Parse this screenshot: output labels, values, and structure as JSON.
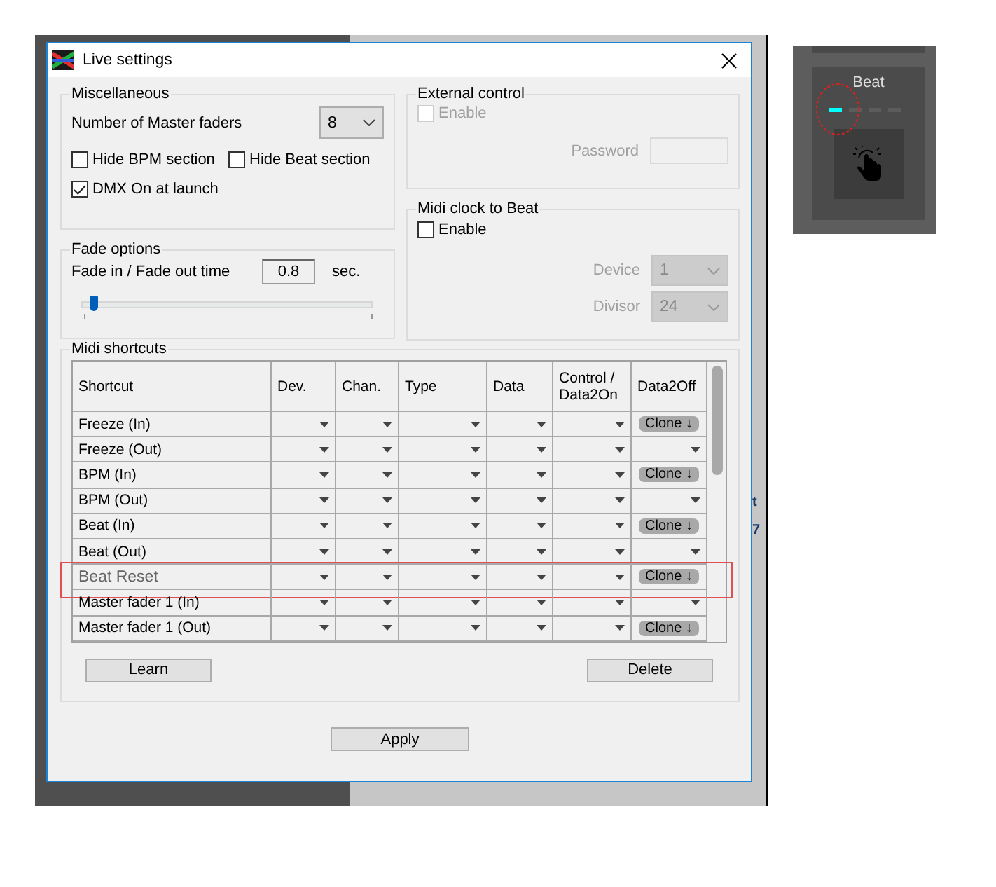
{
  "background": {
    "fragments": [
      "t",
      "7"
    ]
  },
  "beat_panel": {
    "label": "Beat",
    "steps": [
      {
        "active": true
      },
      {
        "active": false
      },
      {
        "active": false
      },
      {
        "active": false
      }
    ],
    "annotated": true
  },
  "window": {
    "title": "Live settings"
  },
  "miscellaneous": {
    "title": "Miscellaneous",
    "master_faders": {
      "label": "Number of Master faders",
      "value": "8"
    },
    "checkboxes": [
      {
        "label": "Hide BPM section",
        "checked": false
      },
      {
        "label": "Hide Beat section",
        "checked": false
      },
      {
        "label": "DMX On at launch",
        "checked": true
      }
    ]
  },
  "fade_options": {
    "title": "Fade options",
    "label": "Fade in / Fade out time",
    "value": "0.8",
    "unit": "sec.",
    "level": 0.04
  },
  "external_control": {
    "title": "External control",
    "enable": {
      "label": "Enable",
      "checked": false,
      "disabled": true
    },
    "password": {
      "label": "Password",
      "disabled": true
    }
  },
  "midi_clock": {
    "title": "Midi clock to Beat",
    "enable": {
      "label": "Enable",
      "checked": false,
      "disabled": false
    },
    "device": {
      "label": "Device",
      "value": "1",
      "disabled": true
    },
    "divisor": {
      "label": "Divisor",
      "value": "24",
      "disabled": true
    }
  },
  "midi_shortcuts": {
    "title": "Midi shortcuts",
    "columns": [
      "Shortcut",
      "Dev.",
      "Chan.",
      "Type",
      "Data",
      "Control / Data2On",
      "Data2Off"
    ],
    "rows": [
      {
        "shortcut": "Freeze (In)",
        "annotated": false,
        "data2off": {
          "kind": "clone",
          "label": "Clone ↓"
        }
      },
      {
        "shortcut": "Freeze (Out)",
        "annotated": false,
        "data2off": {
          "kind": "dropdown"
        }
      },
      {
        "shortcut": "BPM (In)",
        "annotated": false,
        "data2off": {
          "kind": "clone",
          "label": "Clone ↓"
        }
      },
      {
        "shortcut": "BPM (Out)",
        "annotated": false,
        "data2off": {
          "kind": "dropdown"
        }
      },
      {
        "shortcut": "Beat (In)",
        "annotated": false,
        "data2off": {
          "kind": "clone",
          "label": "Clone ↓"
        }
      },
      {
        "shortcut": "Beat (Out)",
        "annotated": false,
        "data2off": {
          "kind": "dropdown"
        }
      },
      {
        "shortcut": "Beat Reset",
        "annotated": true,
        "data2off": {
          "kind": "clone",
          "label": "Clone ↓"
        }
      },
      {
        "shortcut": "Master fader 1 (In)",
        "annotated": false,
        "data2off": {
          "kind": "dropdown"
        }
      },
      {
        "shortcut": "Master fader 1 (Out)",
        "annotated": false,
        "data2off": {
          "kind": "clone",
          "label": "Clone ↓"
        }
      }
    ],
    "buttons": [
      "Learn",
      "Delete"
    ]
  },
  "apply": "Apply"
}
